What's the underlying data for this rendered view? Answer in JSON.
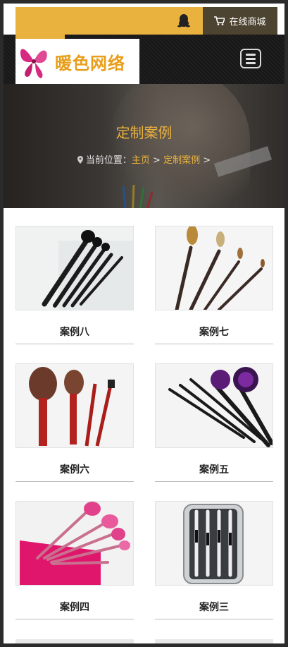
{
  "header": {
    "qq_icon": "qq-penguin-icon",
    "shop_label": "在线商城",
    "shop_icon": "cart-icon",
    "logo_text": "暖色网络",
    "menu_icon": "hamburger-menu-icon",
    "colors": {
      "accent": "#e9b13d",
      "dark": "#1d1d1d",
      "shop_bg": "#4c4330"
    }
  },
  "banner": {
    "title": "定制案例",
    "breadcrumb": {
      "prefix": "当前位置：",
      "home": "主页",
      "sep1": " > ",
      "current": "定制案例",
      "sep2": " >"
    }
  },
  "cases": [
    {
      "label": "案例八"
    },
    {
      "label": "案例七"
    },
    {
      "label": "案例六"
    },
    {
      "label": "案例五"
    },
    {
      "label": "案例四"
    },
    {
      "label": "案例三"
    }
  ]
}
